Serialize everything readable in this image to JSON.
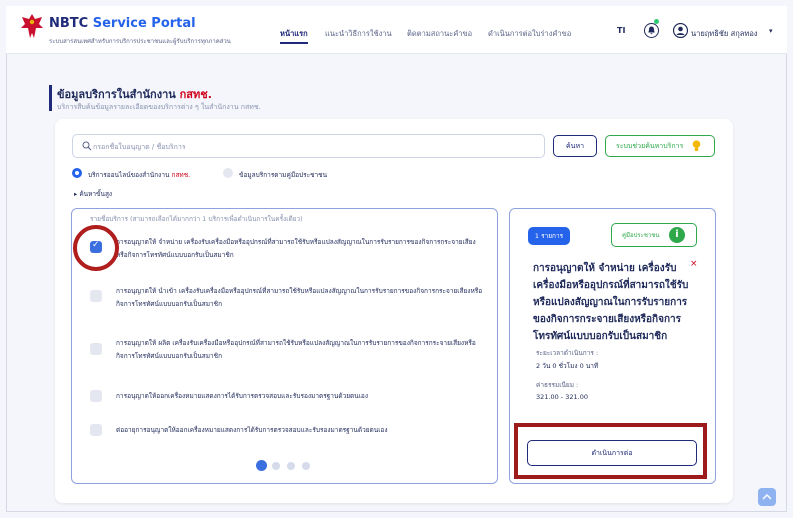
{
  "header": {
    "brand": "NBTC",
    "brand_accent": "Service Portal",
    "tagline": "ระบบสารสนเทศสำหรับการบริการประชาชนและผู้รับบริการทุกภาคส่วน",
    "nav": [
      "หน้าแรก",
      "แนะนำวิธีการใช้งาน",
      "ติดตามสถานะคำขอ",
      "ดำเนินการต่อใบร่างคำขอ"
    ],
    "active_nav": "หน้าแรก",
    "font_size_icon": "TI",
    "user_name": "นายฤทธิชัย สกุลทอง",
    "caret": "▾"
  },
  "page": {
    "title": "ข้อมูลบริการในสำนักงาน",
    "title_accent": "กสทช.",
    "subtitle": "บริการสืบค้นข้อมูลรายละเอียดของบริการต่าง ๆ ในสำนักงาน กสทช."
  },
  "search": {
    "placeholder": "กรอกชื่อใบอนุญาต / ชื่อบริการ",
    "search_label": "ค้นหา",
    "assist_label": "ระบบช่วยค้นหาบริการ"
  },
  "filters": {
    "radio_1_prefix": "บริการออนไลน์ของสำนักงาน",
    "radio_1_accent": "กสทช.",
    "radio_2": "ข้อมูลบริการตามคู่มือประชาชน",
    "advanced": "▸  ค้นหาขั้นสูง"
  },
  "list": {
    "hint": "รายชื่อบริการ (สามารถเลือกได้มากกว่า 1 บริการเพื่อดำเนินการในครั้งเดียว)",
    "items": [
      {
        "text": "การอนุญาตให้ จำหน่าย เครื่องรับเครื่องมือหรืออุปกรณ์ที่สามารถใช้รับหรือแปลงสัญญาณในการรับรายการของกิจการกระจายเสียงหรือกิจการโทรทัศน์แบบบอกรับเป็นสมาชิก",
        "checked": true
      },
      {
        "text": "การอนุญาตให้ นำเข้า เครื่องรับเครื่องมือหรืออุปกรณ์ที่สามารถใช้รับหรือแปลงสัญญาณในการรับรายการของกิจการกระจายเสียงหรือกิจการโทรทัศน์แบบบอกรับเป็นสมาชิก",
        "checked": false
      },
      {
        "text": "การอนุญาตให้ ผลิต เครื่องรับเครื่องมือหรืออุปกรณ์ที่สามารถใช้รับหรือแปลงสัญญาณในการรับรายการของกิจการกระจายเสียงหรือกิจการโทรทัศน์แบบบอกรับเป็นสมาชิก",
        "checked": false
      },
      {
        "text": "การอนุญาตให้ออกเครื่องหมายแสดงการได้รับการตรวจสอบและรับรองมาตรฐานด้วยตนเอง",
        "checked": false
      },
      {
        "text": "ต่ออายุการอนุญาตให้ออกเครื่องหมายแสดงการได้รับการตรวจสอบและรับรองมาตรฐานด้วยตนเอง",
        "checked": false
      }
    ],
    "page_count": 4,
    "current_page": 1
  },
  "selection": {
    "count_label": "1 รายการ",
    "manual_label": "คู่มือประชาชน",
    "info_glyph": "i",
    "close_glyph": "×",
    "title": "การอนุญาตให้ จำหน่าย เครื่องรับเครื่องมือหรืออุปกรณ์ที่สามารถใช้รับหรือแปลงสัญญาณในการรับรายการของกิจการกระจายเสียงหรือกิจการโทรทัศน์แบบบอกรับเป็นสมาชิก",
    "duration_label": "ระยะเวลาดำเนินการ :",
    "duration_value": "2 วัน 0 ชั่วโมง 0 นาที",
    "fee_label": "ค่าธรรมเนียม :",
    "fee_value": "321.00 - 321.00",
    "proceed_label": "ดำเนินการต่อ"
  },
  "colors": {
    "primary": "#1f2a7a",
    "accent_blue": "#2563eb",
    "accent_red": "#d0021b",
    "accent_green": "#2ea84b",
    "annotation_red": "#9e1b1b"
  }
}
